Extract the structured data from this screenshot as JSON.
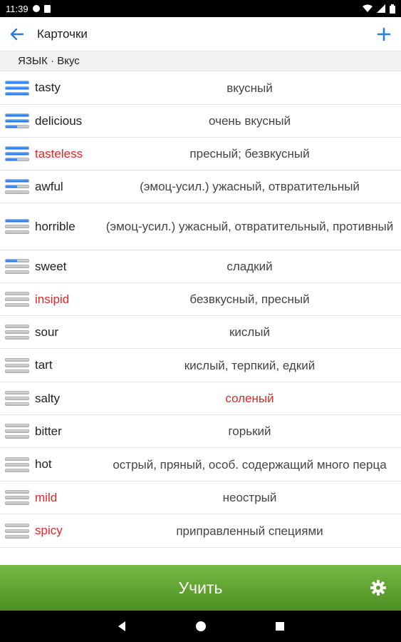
{
  "status_bar": {
    "time": "11:39"
  },
  "app_bar": {
    "title": "Карточки"
  },
  "section": {
    "title": "ЯЗЫК · Вкус"
  },
  "colors": {
    "accent": "#2a7be4",
    "learned": "#e32626",
    "learn_bar": "#5f9e31"
  },
  "cards": [
    {
      "word": "tasty",
      "translation": "вкусный",
      "level": 5,
      "word_red": false,
      "trans_red": false
    },
    {
      "word": "delicious",
      "translation": "очень вкусный",
      "level": 4,
      "word_red": false,
      "trans_red": false
    },
    {
      "word": "tasteless",
      "translation": "пресный; безвкусный",
      "level": 4,
      "word_red": true,
      "trans_red": false
    },
    {
      "word": "awful",
      "translation": "(эмоц-усил.) ужасный, отвратительный",
      "level": 3,
      "word_red": false,
      "trans_red": false
    },
    {
      "word": "horrible",
      "translation": "(эмоц-усил.) ужасный, отвратительный, противный",
      "level": 2,
      "word_red": false,
      "trans_red": false
    },
    {
      "word": "sweet",
      "translation": "сладкий",
      "level": 1,
      "word_red": false,
      "trans_red": false
    },
    {
      "word": "insipid",
      "translation": "безвкусный, пресный",
      "level": 0,
      "word_red": true,
      "trans_red": false
    },
    {
      "word": "sour",
      "translation": "кислый",
      "level": 0,
      "word_red": false,
      "trans_red": false
    },
    {
      "word": "tart",
      "translation": "кислый, терпкий, едкий",
      "level": 0,
      "word_red": false,
      "trans_red": false
    },
    {
      "word": "salty",
      "translation": "соленый",
      "level": 0,
      "word_red": false,
      "trans_red": true
    },
    {
      "word": "bitter",
      "translation": "горький",
      "level": 0,
      "word_red": false,
      "trans_red": false
    },
    {
      "word": "hot",
      "translation": "острый, пряный, особ. содержащий много перца",
      "level": 0,
      "word_red": false,
      "trans_red": false
    },
    {
      "word": "mild",
      "translation": "неострый",
      "level": 0,
      "word_red": true,
      "trans_red": false
    },
    {
      "word": "spicy",
      "translation": "приправленный специями",
      "level": 0,
      "word_red": true,
      "trans_red": false
    }
  ],
  "learn_button": {
    "label": "Учить"
  },
  "icons": {
    "back": "arrow-left-icon",
    "add": "plus-icon",
    "settings": "gear-icon"
  }
}
